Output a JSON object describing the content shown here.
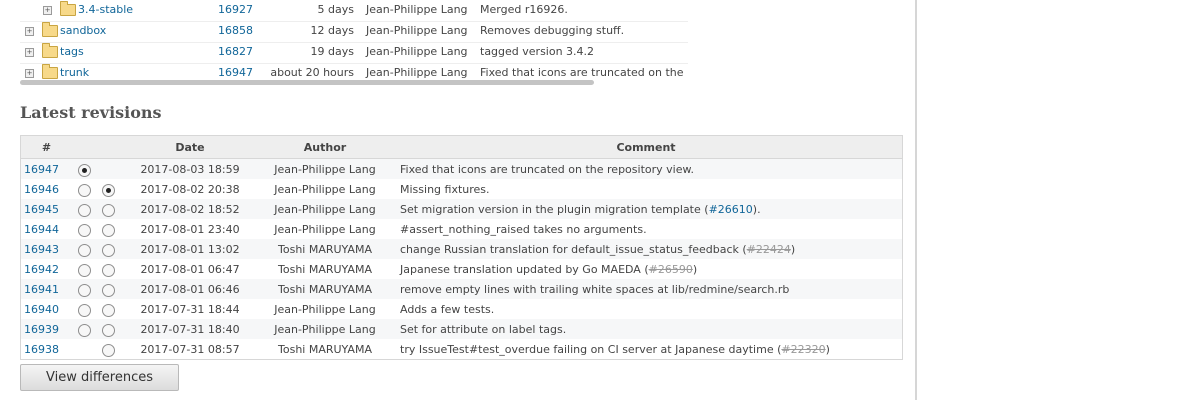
{
  "tree": [
    {
      "indent": 1,
      "name": "3.4-stable",
      "rev": "16927",
      "age": "5 days",
      "author": "Jean-Philippe Lang",
      "comment": "Merged r16926."
    },
    {
      "indent": 0,
      "name": "sandbox",
      "rev": "16858",
      "age": "12 days",
      "author": "Jean-Philippe Lang",
      "comment": "Removes debugging stuff."
    },
    {
      "indent": 0,
      "name": "tags",
      "rev": "16827",
      "age": "19 days",
      "author": "Jean-Philippe Lang",
      "comment": "tagged version 3.4.2"
    },
    {
      "indent": 0,
      "name": "trunk",
      "rev": "16947",
      "age": "about 20 hours",
      "author": "Jean-Philippe Lang",
      "comment": "Fixed that icons are truncated on the r"
    }
  ],
  "latest": {
    "title": "Latest revisions",
    "headers": {
      "id": "#",
      "date": "Date",
      "author": "Author",
      "comment": "Comment"
    },
    "rows": [
      {
        "id": "16947",
        "r1": true,
        "r1_checked": true,
        "r2": false,
        "r2_checked": false,
        "date": "2017-08-03 18:59",
        "author": "Jean-Philippe Lang",
        "comment": [
          {
            "t": "Fixed that icons are truncated on the repository view."
          }
        ]
      },
      {
        "id": "16946",
        "r1": true,
        "r1_checked": false,
        "r2": true,
        "r2_checked": true,
        "date": "2017-08-02 20:38",
        "author": "Jean-Philippe Lang",
        "comment": [
          {
            "t": "Missing fixtures."
          }
        ]
      },
      {
        "id": "16945",
        "r1": true,
        "r1_checked": false,
        "r2": true,
        "r2_checked": false,
        "date": "2017-08-02 18:52",
        "author": "Jean-Philippe Lang",
        "comment": [
          {
            "t": "Set migration version in the plugin migration template ("
          },
          {
            "t": "#26610",
            "link": true
          },
          {
            "t": ")."
          }
        ]
      },
      {
        "id": "16944",
        "r1": true,
        "r1_checked": false,
        "r2": true,
        "r2_checked": false,
        "date": "2017-08-01 23:40",
        "author": "Jean-Philippe Lang",
        "comment": [
          {
            "t": "#assert_nothing_raised takes no arguments."
          }
        ]
      },
      {
        "id": "16943",
        "r1": true,
        "r1_checked": false,
        "r2": true,
        "r2_checked": false,
        "date": "2017-08-01 13:02",
        "author": "Toshi MARUYAMA",
        "comment": [
          {
            "t": "change Russian translation for default_issue_status_feedback ("
          },
          {
            "t": "#22424",
            "closed": true
          },
          {
            "t": ")"
          }
        ]
      },
      {
        "id": "16942",
        "r1": true,
        "r1_checked": false,
        "r2": true,
        "r2_checked": false,
        "date": "2017-08-01 06:47",
        "author": "Toshi MARUYAMA",
        "comment": [
          {
            "t": "Japanese translation updated by Go MAEDA ("
          },
          {
            "t": "#26590",
            "closed": true
          },
          {
            "t": ")"
          }
        ]
      },
      {
        "id": "16941",
        "r1": true,
        "r1_checked": false,
        "r2": true,
        "r2_checked": false,
        "date": "2017-08-01 06:46",
        "author": "Toshi MARUYAMA",
        "comment": [
          {
            "t": "remove empty lines with trailing white spaces at lib/redmine/search.rb"
          }
        ]
      },
      {
        "id": "16940",
        "r1": true,
        "r1_checked": false,
        "r2": true,
        "r2_checked": false,
        "date": "2017-07-31 18:44",
        "author": "Jean-Philippe Lang",
        "comment": [
          {
            "t": "Adds a few tests."
          }
        ]
      },
      {
        "id": "16939",
        "r1": true,
        "r1_checked": false,
        "r2": true,
        "r2_checked": false,
        "date": "2017-07-31 18:40",
        "author": "Jean-Philippe Lang",
        "comment": [
          {
            "t": "Set for attribute on label tags."
          }
        ]
      },
      {
        "id": "16938",
        "r1": false,
        "r1_checked": false,
        "r2": true,
        "r2_checked": false,
        "date": "2017-07-31 08:57",
        "author": "Toshi MARUYAMA",
        "comment": [
          {
            "t": "try IssueTest#test_overdue failing on CI server at Japanese daytime ("
          },
          {
            "t": "#22320",
            "closed": true
          },
          {
            "t": ")"
          }
        ]
      }
    ]
  },
  "button": {
    "label": "View differences"
  },
  "colors": {
    "link": "#116699",
    "row_alt": "#f6f7f8",
    "header_bg": "#eeeeee"
  }
}
